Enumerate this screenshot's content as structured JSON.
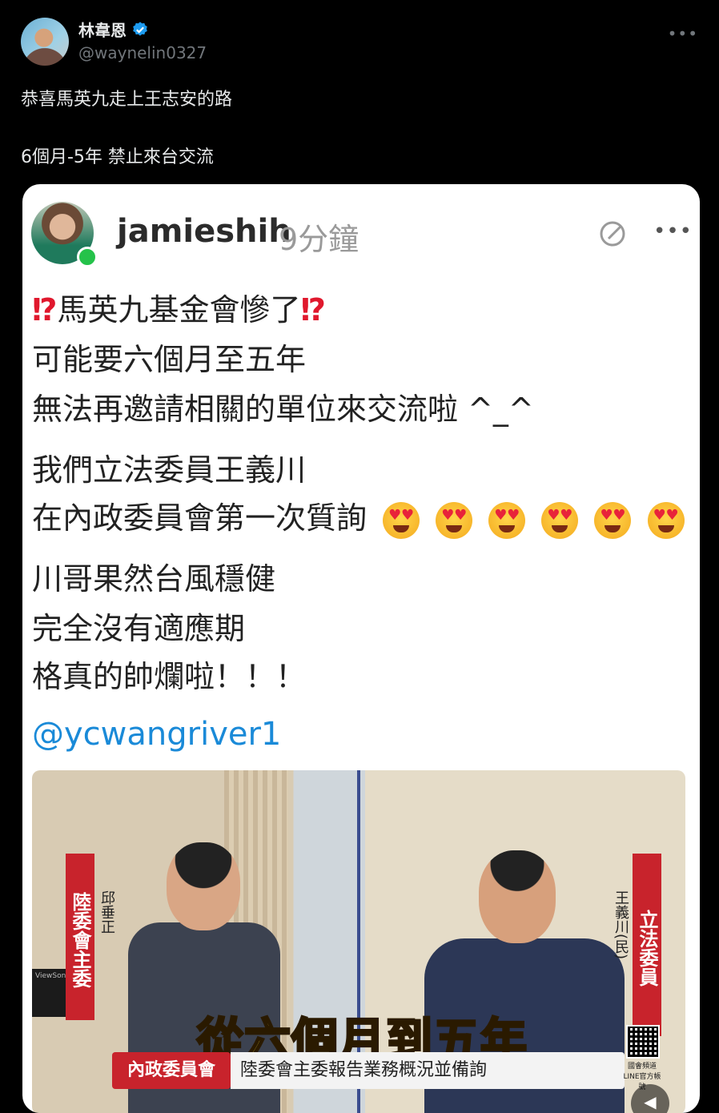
{
  "tweet": {
    "author_name": "林韋恩",
    "author_handle": "@waynelin0327",
    "more_label": "•••",
    "lines": [
      "恭喜馬英九走上王志安的路",
      "6個月-5年 禁止來台交流"
    ]
  },
  "embedded_post": {
    "username": "jamieshih",
    "time": "9分鐘",
    "more_label": "•••",
    "line1_emoji": "⁉",
    "line1_text": "馬英九基金會慘了",
    "line2": "可能要六個月至五年",
    "line3": "無法再邀請相關的單位來交流啦 ^_^",
    "line4": "我們立法委員王義川",
    "line5": "在內政委員會第一次質詢",
    "line6": "川哥果然台風穩健",
    "line7": "完全沒有適應期",
    "line8": "格真的帥爛啦！！！",
    "mention": "@ycwangriver1",
    "video": {
      "left_title": "陸委會主委",
      "left_name": "邱垂正",
      "right_title": "立法委員",
      "right_name": "王義川(民)",
      "caption": "從六個月到五年",
      "banner_red": "內政委員會",
      "banner_white": "陸委會主委報告業務概況並備詢",
      "qr_text": "國會頻道 LINE官方帳號",
      "monitor_brand": "ViewSonic"
    }
  },
  "colors": {
    "background": "#000000",
    "verified": "#1d9bf0",
    "mention": "#1a8ad8",
    "label_red": "#c8232c",
    "caption_yellow": "#ffe94d"
  }
}
